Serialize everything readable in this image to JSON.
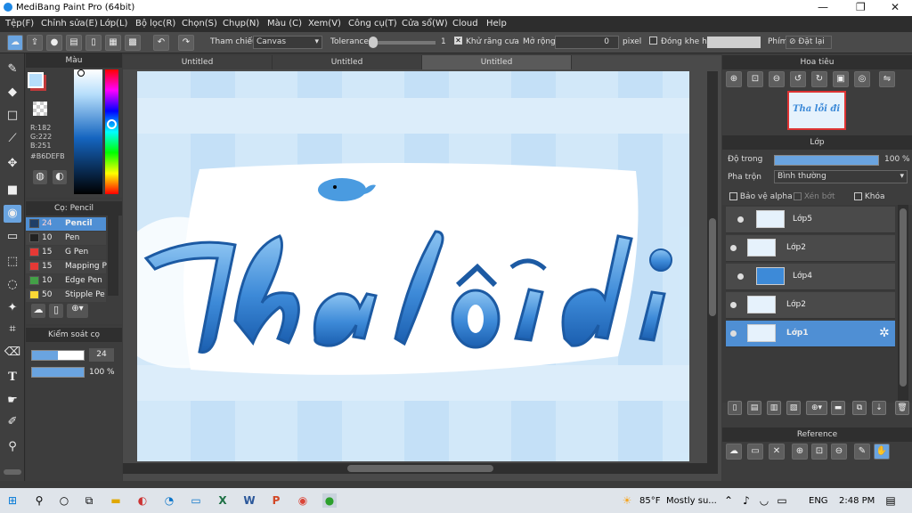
{
  "window": {
    "title": "MediBang Paint Pro (64bit)"
  },
  "menu": [
    "Tệp(F)",
    "Chỉnh sửa(E)",
    "Lớp(L)",
    "Bộ lọc(R)",
    "Chọn(S)",
    "Chụp(N)",
    "Màu (C)",
    "Xem(V)",
    "Công cụ(T)",
    "Cửa sổ(W)",
    "Cloud",
    "Help"
  ],
  "toolbar": {
    "ref_label": "Tham chiếu",
    "ref_value": "Canvas",
    "tolerance_label": "Tolerance",
    "tolerance_value": "1",
    "antialias_label": "Khử răng cưa",
    "expand_label": "Mở rộng",
    "expand_value": "0",
    "pixel_label": "pixel",
    "gap_label": "Đóng khe hở",
    "shortcut_label": "Phím",
    "reset_label": "Đặt lại"
  },
  "color_panel": {
    "title": "Màu",
    "r": "R:182",
    "g": "G:222",
    "b": "B:251",
    "hex": "#B6DEFB",
    "fg": "#b6defb",
    "bg": "#c0393b"
  },
  "brush_panel": {
    "title": "Cọ: Pencil",
    "brushes": [
      {
        "size": "24",
        "name": "Pencil",
        "color": "#1f3e67",
        "active": true
      },
      {
        "size": "10",
        "name": "Pen",
        "color": "#222222"
      },
      {
        "size": "15",
        "name": "G Pen",
        "color": "#e53935"
      },
      {
        "size": "15",
        "name": "Mapping P",
        "color": "#e53935"
      },
      {
        "size": "10",
        "name": "Edge Pen",
        "color": "#43a047"
      },
      {
        "size": "50",
        "name": "Stipple Pe",
        "color": "#fdd835"
      }
    ]
  },
  "control_panel": {
    "title": "Kiểm soát cọ",
    "size": "24",
    "opacity": "100 %",
    "opacity_fraction": 1.0
  },
  "doc_tabs": [
    "Untitled",
    "Untitled",
    "Untitled"
  ],
  "artwork": {
    "text": "Tha lỗi đi"
  },
  "navigator": {
    "title": "Hoa tiêu",
    "thumb_text": "Tha lỗi đi"
  },
  "layer_panel": {
    "title": "Lớp",
    "opacity_label": "Độ trong",
    "opacity_value": "100 %",
    "blend_label": "Pha trộn",
    "blend_value": "Bình thường",
    "protect_alpha": "Bảo vệ alpha",
    "clipping": "Xén bớt",
    "lock": "Khóa",
    "layers": [
      {
        "name": "Lớp5",
        "indent": true,
        "selected": false
      },
      {
        "name": "Lớp2",
        "indent": false,
        "selected": false
      },
      {
        "name": "Lớp4",
        "indent": true,
        "selected": false
      },
      {
        "name": "Lớp2",
        "indent": false,
        "selected": false
      },
      {
        "name": "Lớp1",
        "indent": false,
        "selected": true
      }
    ]
  },
  "reference_panel": {
    "title": "Reference"
  },
  "taskbar": {
    "weather_temp": "85°F",
    "weather_text": "Mostly su...",
    "lang": "ENG",
    "time": "2:48 PM"
  },
  "colors": {
    "accent": "#4f8fd4",
    "canvas_bg": "#cfe6f8",
    "letter": "#3d8ad8"
  }
}
